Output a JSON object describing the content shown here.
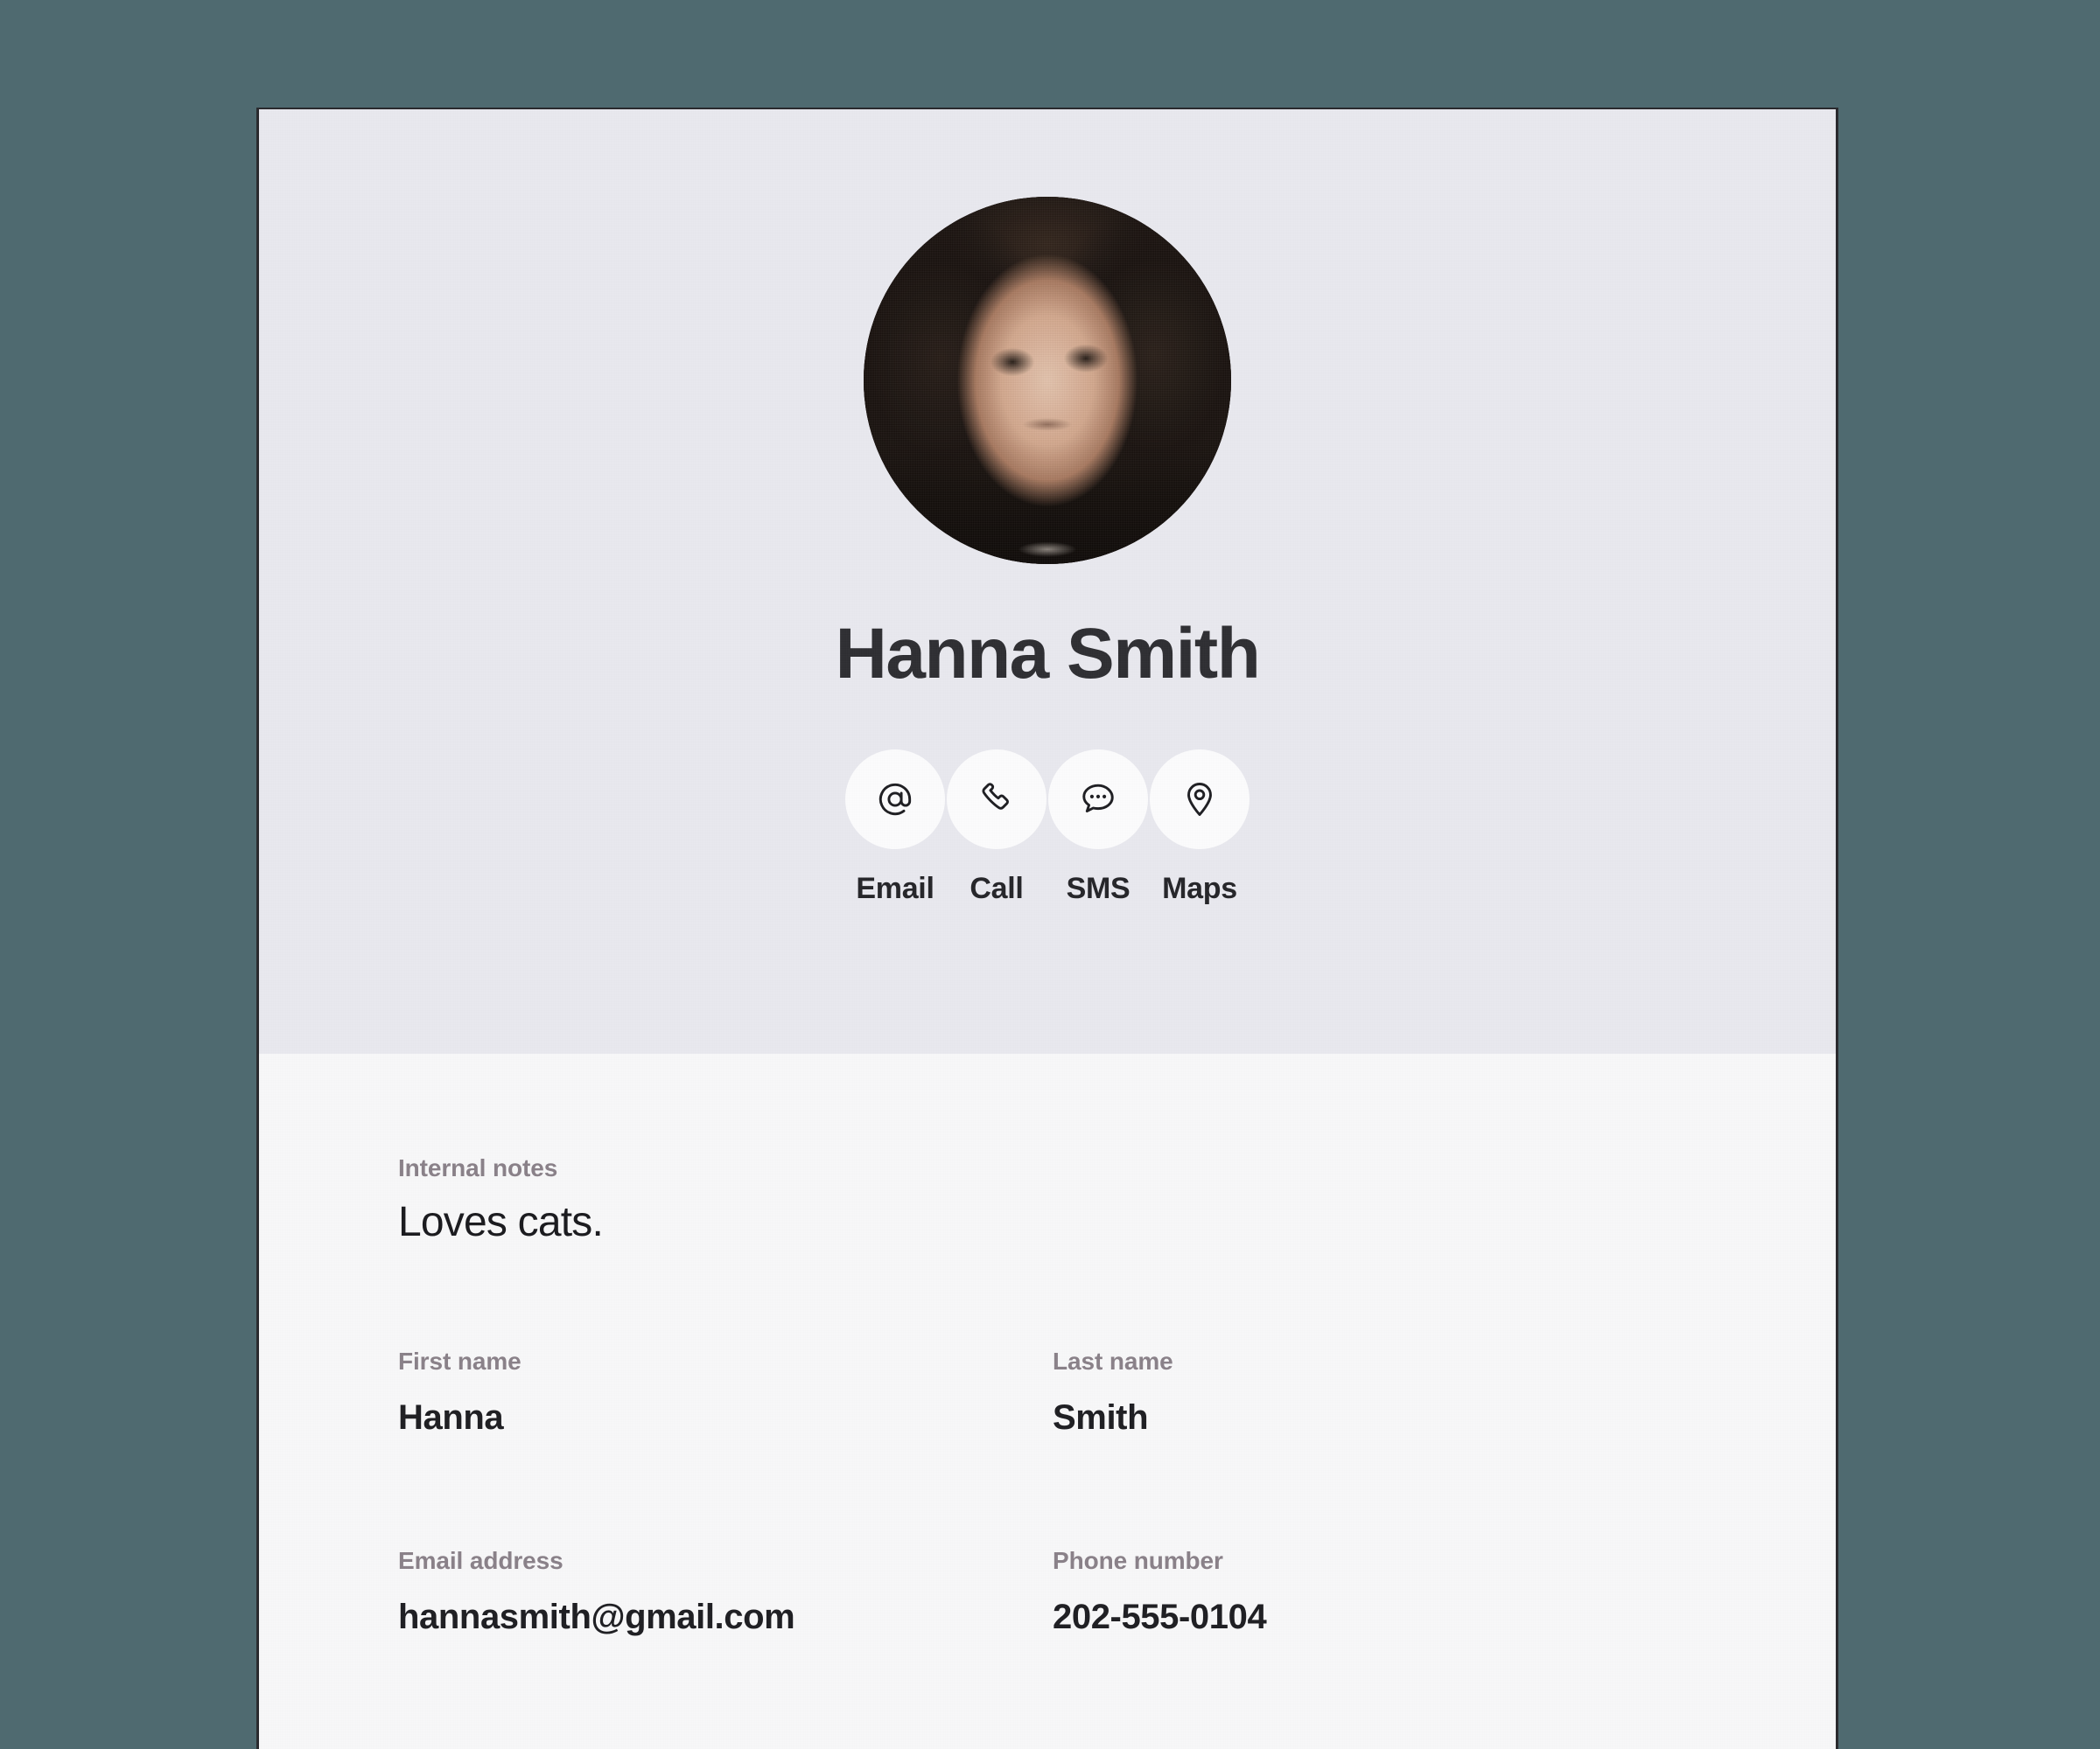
{
  "card": {
    "background_header": "#e8e8ee",
    "background_body": "#f7f7f8",
    "backdrop": "#4f6a70"
  },
  "header": {
    "avatar_alt": "Hanna Smith profile photo",
    "name": "Hanna Smith",
    "actions": [
      {
        "label": "Email",
        "icon": "at-sign-icon"
      },
      {
        "label": "Call",
        "icon": "phone-icon"
      },
      {
        "label": "SMS",
        "icon": "chat-bubble-icon"
      },
      {
        "label": "Maps",
        "icon": "map-pin-icon"
      }
    ]
  },
  "details": {
    "notes": {
      "label": "Internal notes",
      "value": "Loves cats."
    },
    "first_name": {
      "label": "First name",
      "value": "Hanna"
    },
    "last_name": {
      "label": "Last name",
      "value": "Smith"
    },
    "email": {
      "label": "Email address",
      "value": "hannasmith@gmail.com"
    },
    "phone": {
      "label": "Phone number",
      "value": "202-555-0104"
    }
  }
}
